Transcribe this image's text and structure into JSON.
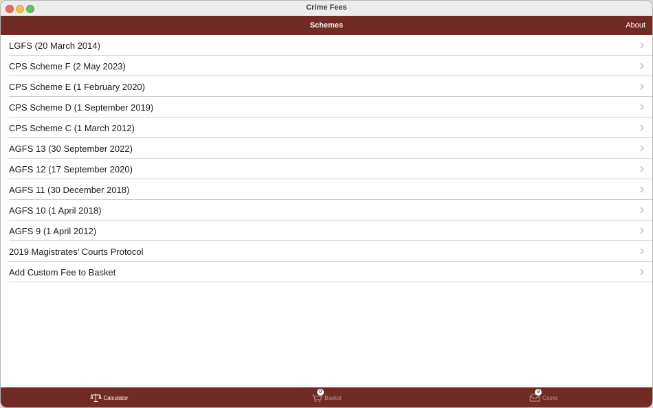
{
  "window": {
    "title": "Crime Fees"
  },
  "navbar": {
    "title": "Schemes",
    "about_label": "About"
  },
  "schemes": [
    {
      "label": "LGFS (20 March 2014)"
    },
    {
      "label": "CPS Scheme F (2 May 2023)"
    },
    {
      "label": "CPS Scheme E (1 February 2020)"
    },
    {
      "label": "CPS Scheme D (1 September 2019)"
    },
    {
      "label": "CPS Scheme C (1 March 2012)"
    },
    {
      "label": "AGFS 13 (30 September 2022)"
    },
    {
      "label": "AGFS 12 (17 September 2020)"
    },
    {
      "label": "AGFS 11 (30 December 2018)"
    },
    {
      "label": "AGFS 10 (1 April 2018)"
    },
    {
      "label": "AGFS 9 (1 April 2012)"
    },
    {
      "label": "2019 Magistrates’ Courts Protocol"
    },
    {
      "label": "Add Custom Fee to Basket"
    }
  ],
  "tabbar": {
    "tabs": [
      {
        "label": "Calculator",
        "icon": "scales-icon",
        "active": true
      },
      {
        "label": "Basket",
        "icon": "basket-icon",
        "badge": "0",
        "active": false
      },
      {
        "label": "Cases",
        "icon": "inbox-icon",
        "badge": "8",
        "active": false
      }
    ]
  },
  "colors": {
    "accent": "#722b22",
    "background": "#ffffff",
    "separator": "#cfcfcf"
  }
}
